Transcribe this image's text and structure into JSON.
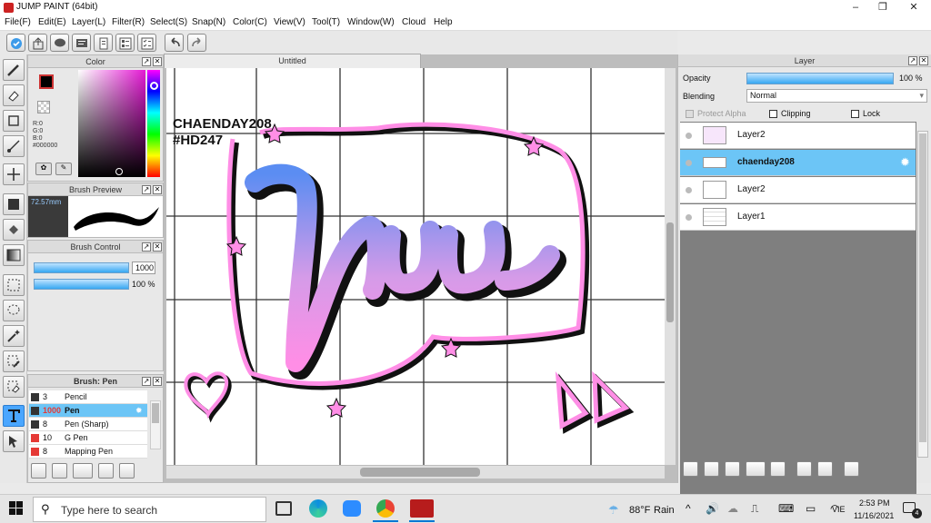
{
  "window": {
    "title": "JUMP PAINT (64bit)",
    "controls": [
      "–",
      "❐",
      "✕"
    ]
  },
  "menu": [
    "File(F)",
    "Edit(E)",
    "Layer(L)",
    "Filter(R)",
    "Select(S)",
    "Snap(N)",
    "Color(C)",
    "View(V)",
    "Tool(T)",
    "Window(W)",
    "Cloud",
    "Help"
  ],
  "color_panel": {
    "title": "Color",
    "r": "R:0",
    "g": "G:0",
    "b": "B:0",
    "hex": "#000000"
  },
  "brush_preview": {
    "title": "Brush Preview",
    "size": "72.57mm"
  },
  "brush_control": {
    "title": "Brush Control",
    "size_value": "1000",
    "opacity_value": "100 %"
  },
  "brush_list": {
    "title": "Brush: Pen",
    "items": [
      {
        "num": "3",
        "name": "Pencil",
        "color": "#333333"
      },
      {
        "num": "1000",
        "name": "Pen",
        "color": "#333333",
        "selected": true
      },
      {
        "num": "8",
        "name": "Pen (Sharp)",
        "color": "#333333"
      },
      {
        "num": "10",
        "name": "G Pen",
        "color": "#e53935"
      },
      {
        "num": "8",
        "name": "Mapping Pen",
        "color": "#e53935"
      }
    ]
  },
  "document": {
    "tab": "Untitled"
  },
  "artwork": {
    "handle_line1": "CHAENDAY208",
    "handle_line2": "#HD247"
  },
  "layer_panel": {
    "title": "Layer",
    "opacity_label": "Opacity",
    "opacity_value": "100 %",
    "opacity_fraction": 1.0,
    "blending_label": "Blending",
    "blending_value": "Normal",
    "protect_alpha": "Protect Alpha",
    "clipping": "Clipping",
    "lock": "Lock",
    "layers": [
      {
        "name": "Layer2",
        "selected": false
      },
      {
        "name": "chaenday208",
        "selected": true
      },
      {
        "name": "Layer2",
        "selected": false
      },
      {
        "name": "Layer1",
        "selected": false
      }
    ]
  },
  "taskbar": {
    "search_placeholder": "Type here to search",
    "weather_temp": "88°F",
    "weather_text": "Rain",
    "lang": "VIE",
    "time": "2:53 PM",
    "date": "11/16/2021",
    "notif_count": "4"
  },
  "colors": {
    "accent": "#37a8f2",
    "selected_layer": "#6cc5f6",
    "art_pink": "#ff8ee6",
    "art_blue": "#5b8df2"
  }
}
